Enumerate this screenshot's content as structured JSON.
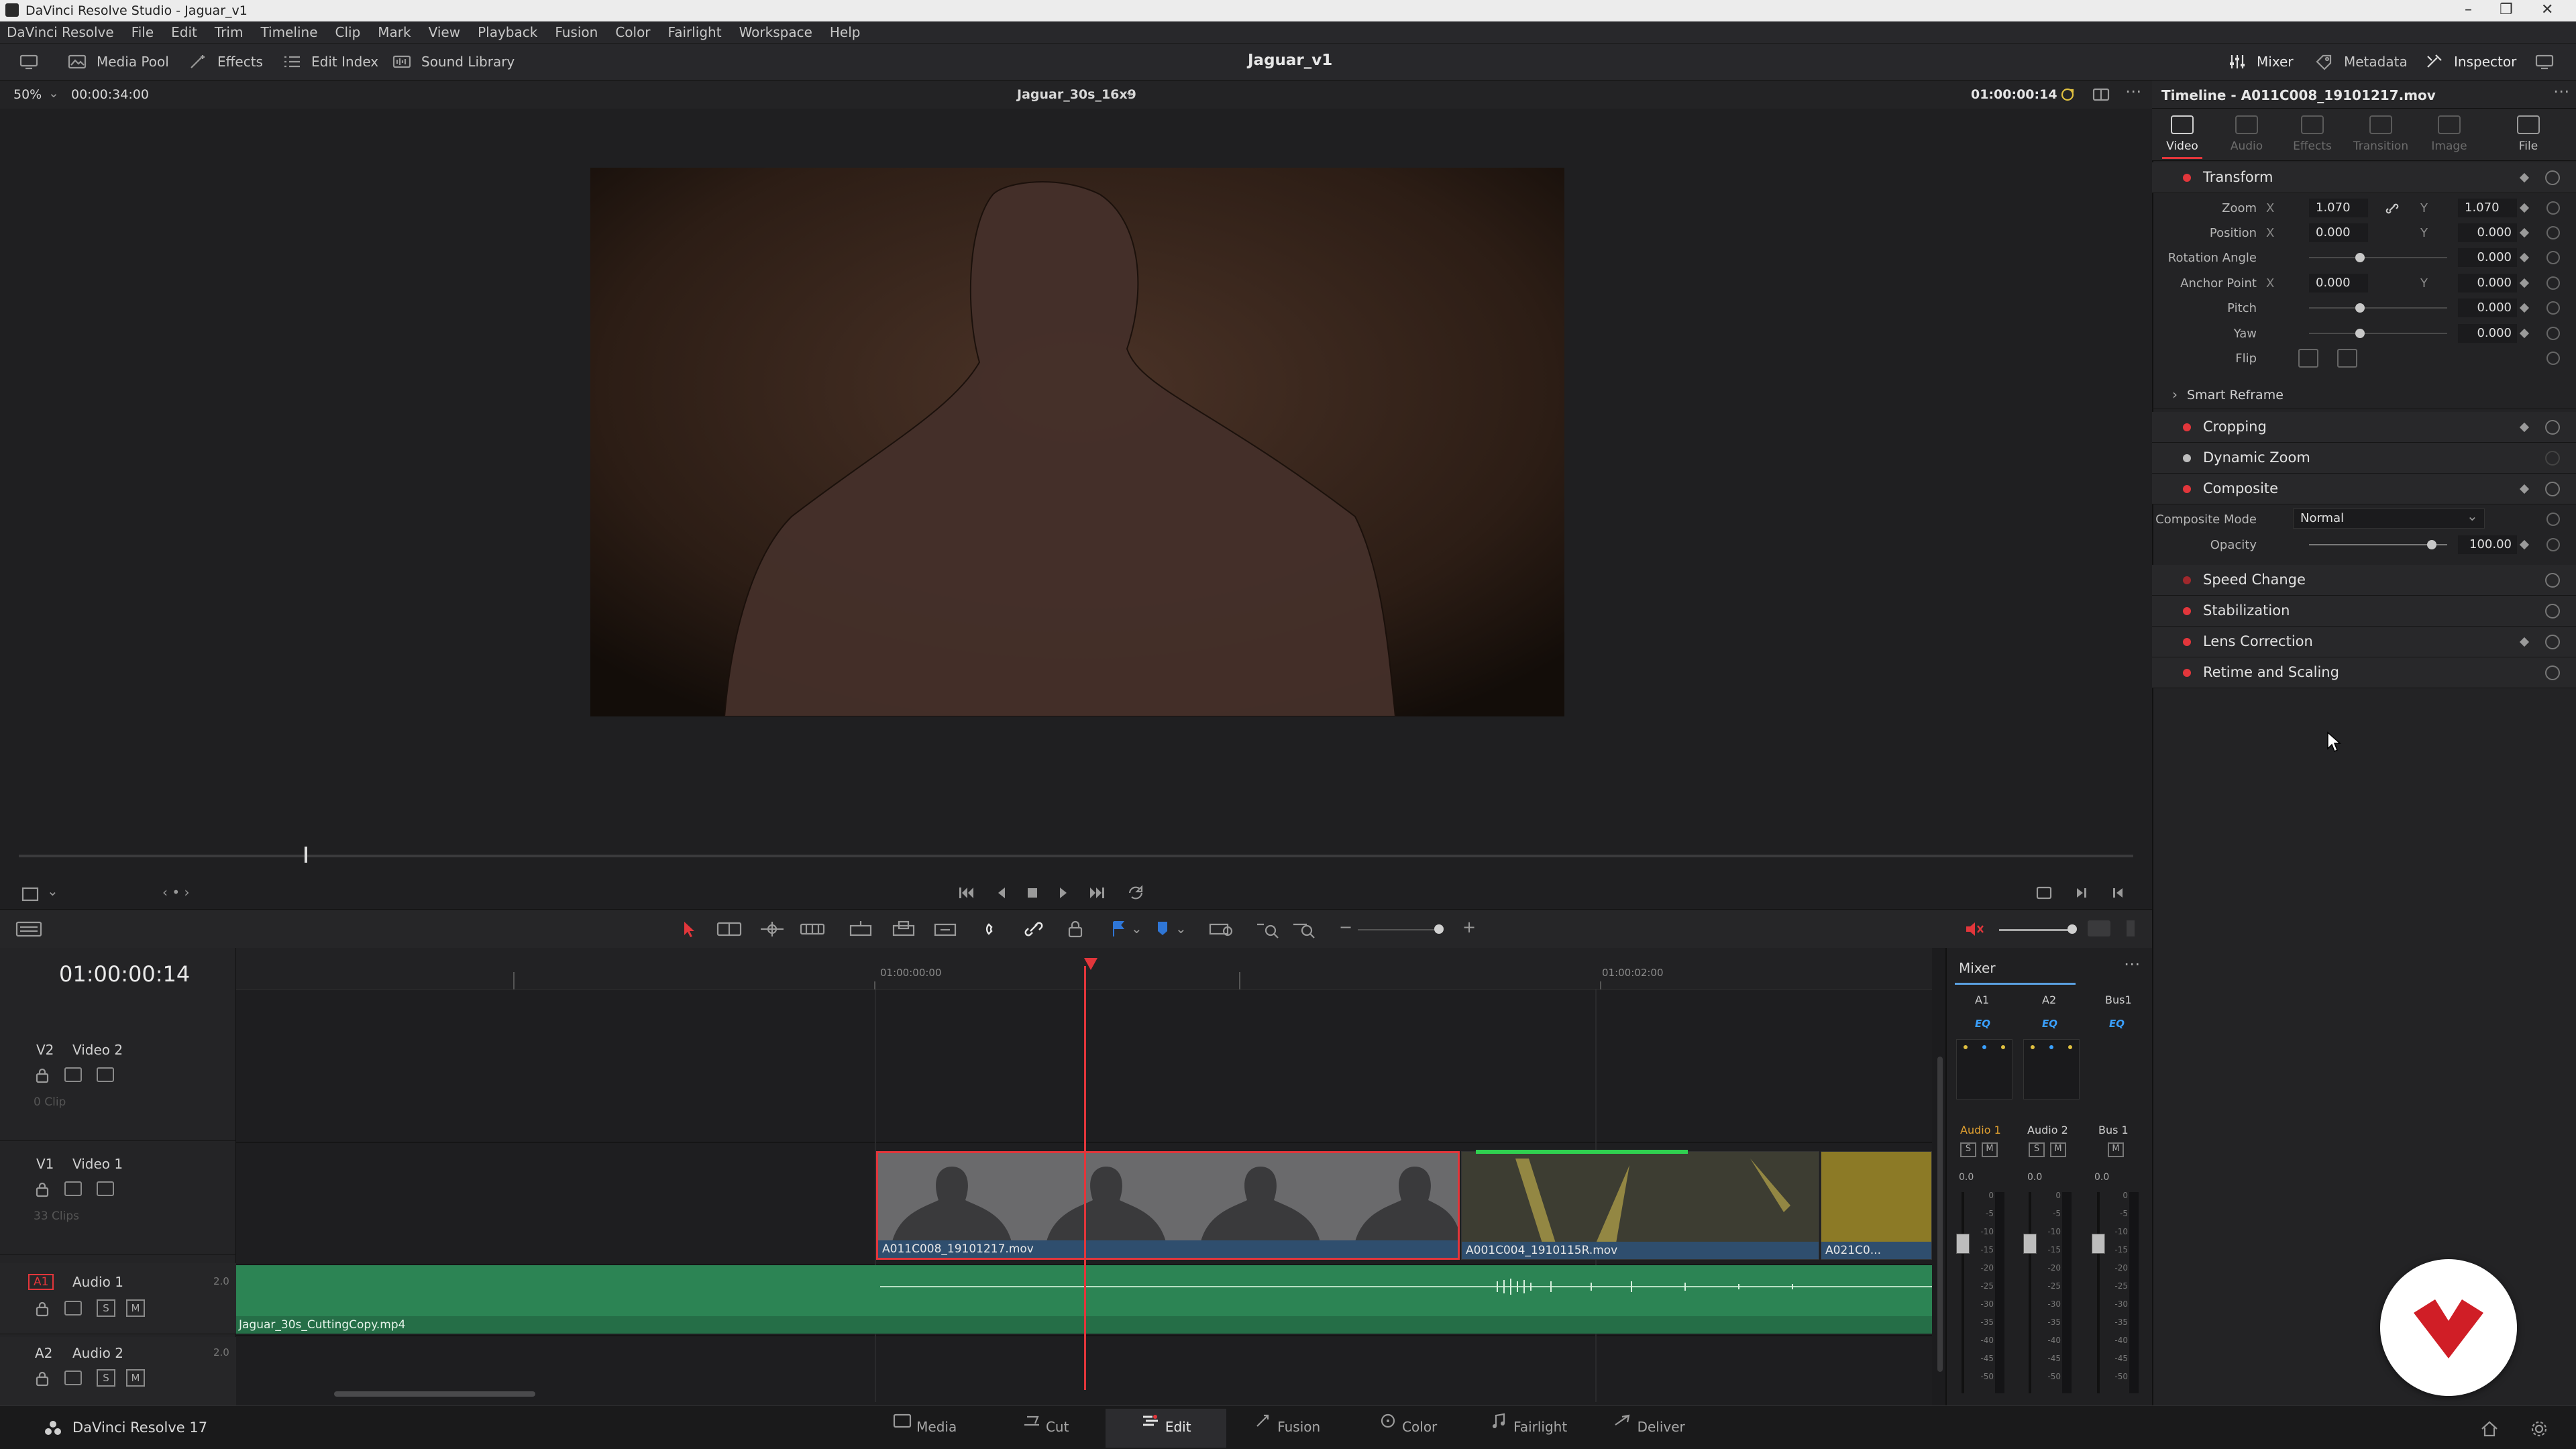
{
  "window": {
    "title": "DaVinci Resolve Studio - Jaguar_v1"
  },
  "menu": [
    "DaVinci Resolve",
    "File",
    "Edit",
    "Trim",
    "Timeline",
    "Clip",
    "Mark",
    "View",
    "Playback",
    "Fusion",
    "Color",
    "Fairlight",
    "Workspace",
    "Help"
  ],
  "toolbar": {
    "media_pool": "Media Pool",
    "effects": "Effects",
    "edit_index": "Edit Index",
    "sound_library": "Sound Library",
    "project_title": "Jaguar_v1",
    "mixer": "Mixer",
    "metadata": "Metadata",
    "inspector": "Inspector"
  },
  "viewer": {
    "zoom": "50%",
    "duration": "00:00:34:00",
    "timeline_name": "Jaguar_30s_16x9",
    "timecode": "01:00:00:14",
    "playhead_fraction": 0.135
  },
  "timeline": {
    "timecode": "01:00:00:14",
    "ruler_marks": [
      "01:00:00:00",
      "01:00:02:00"
    ],
    "tracks": {
      "v2": {
        "id": "V2",
        "name": "Video 2",
        "info": "0 Clip"
      },
      "v1": {
        "id": "V1",
        "name": "Video 1",
        "info": "33 Clips"
      },
      "a1": {
        "id": "A1",
        "name": "Audio 1",
        "channels": "2.0"
      },
      "a2": {
        "id": "A2",
        "name": "Audio 2",
        "channels": "2.0"
      }
    },
    "clips": {
      "clip1": "A011C008_19101217.mov",
      "clip2": "A001C004_1910115R.mov",
      "clip3": "A021C0...",
      "audio": "Jaguar_30s_CuttingCopy.mp4"
    },
    "buttons": {
      "s": "S",
      "m": "M"
    }
  },
  "mixer": {
    "title": "Mixer",
    "channels": [
      "A1",
      "A2",
      "Bus1"
    ],
    "eq": "EQ",
    "strip_names": [
      "Audio 1",
      "Audio 2",
      "Bus 1"
    ],
    "levels": [
      "0.0",
      "0.0",
      "0.0"
    ],
    "scale": [
      "0",
      "-5",
      "-10",
      "-15",
      "-20",
      "-25",
      "-30",
      "-35",
      "-40",
      "-45",
      "-50"
    ]
  },
  "inspector": {
    "header": "Timeline - A011C008_19101217.mov",
    "tabs": [
      "Video",
      "Audio",
      "Effects",
      "Transition",
      "Image",
      "File"
    ],
    "transform": {
      "title": "Transform",
      "zoom_label": "Zoom",
      "zoom_x": "1.070",
      "zoom_y": "1.070",
      "position_label": "Position",
      "position_x": "0.000",
      "position_y": "0.000",
      "rotation_label": "Rotation Angle",
      "rotation": "0.000",
      "anchor_label": "Anchor Point",
      "anchor_x": "0.000",
      "anchor_y": "0.000",
      "pitch_label": "Pitch",
      "pitch": "0.000",
      "yaw_label": "Yaw",
      "yaw": "0.000",
      "flip_label": "Flip",
      "x": "X",
      "y": "Y"
    },
    "smart_reframe": "Smart Reframe",
    "cropping": "Cropping",
    "dynamic_zoom": "Dynamic Zoom",
    "composite": {
      "title": "Composite",
      "mode_label": "Composite Mode",
      "mode_value": "Normal",
      "opacity_label": "Opacity",
      "opacity_value": "100.00"
    },
    "speed_change": "Speed Change",
    "stabilization": "Stabilization",
    "lens_correction": "Lens Correction",
    "retime": "Retime and Scaling"
  },
  "pagebar": {
    "app": "DaVinci Resolve 17",
    "pages": [
      "Media",
      "Cut",
      "Edit",
      "Fusion",
      "Color",
      "Fairlight",
      "Deliver"
    ],
    "active": "Edit"
  },
  "colors": {
    "accent_red": "#e2363b",
    "audio_green": "#2c8454",
    "clip_blue": "#2f4e6e",
    "playhead": "#e2363b"
  }
}
